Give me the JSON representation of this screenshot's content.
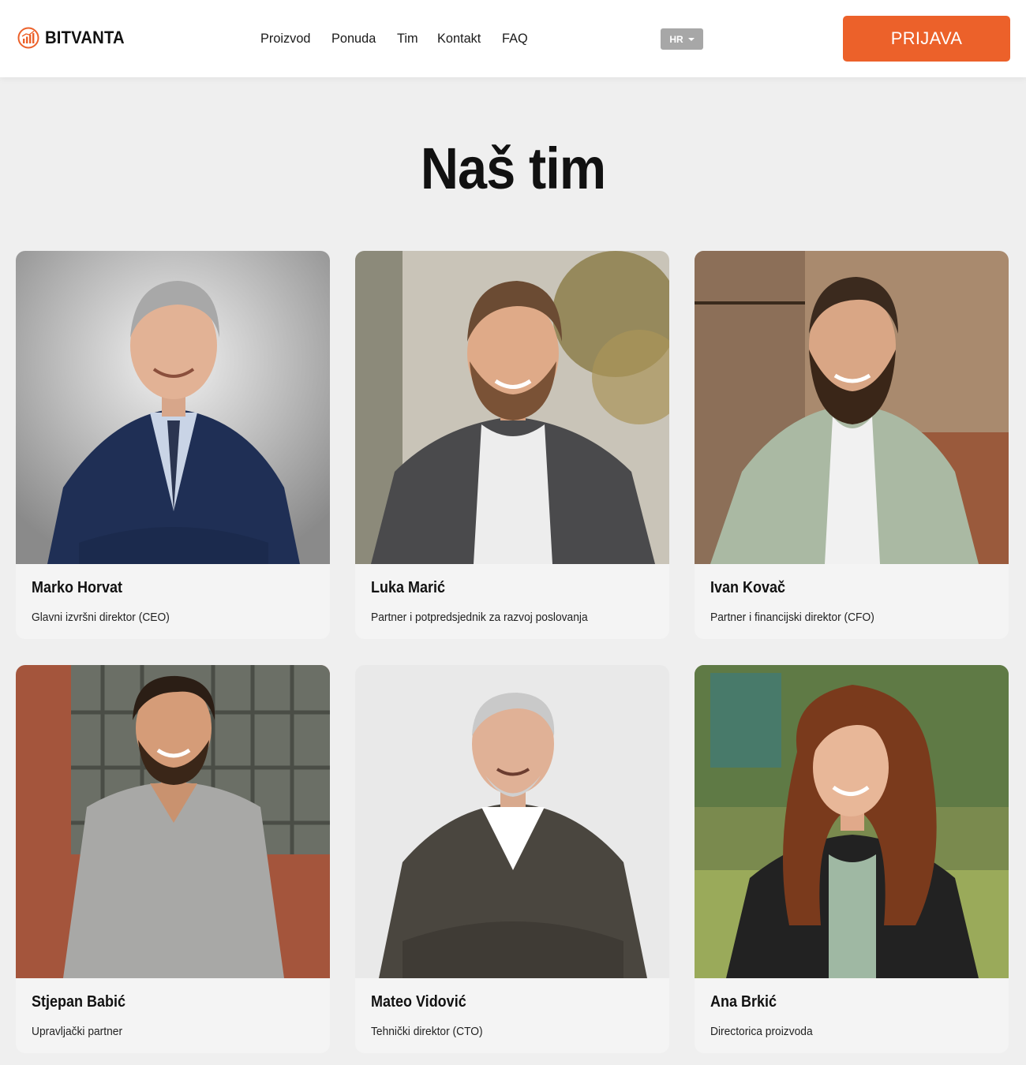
{
  "brand": {
    "name": "BITVANTA",
    "accent": "#ec612a"
  },
  "nav": [
    {
      "label": "Proizvod"
    },
    {
      "label": "Ponuda"
    },
    {
      "label": "Tim"
    },
    {
      "label": "Kontakt"
    },
    {
      "label": "FAQ"
    }
  ],
  "language": {
    "selected": "HR"
  },
  "login": {
    "label": "PRIJAVA"
  },
  "section": {
    "title": "Naš tim"
  },
  "team": [
    {
      "name": "Marko Horvat",
      "role": "Glavni izvršni direktor (CEO)"
    },
    {
      "name": "Luka Marić",
      "role": "Partner i potpredsjednik za razvoj poslovanja"
    },
    {
      "name": "Ivan Kovač",
      "role": "Partner i financijski direktor (CFO)"
    },
    {
      "name": "Stjepan Babić",
      "role": "Upravljački partner"
    },
    {
      "name": "Mateo Vidović",
      "role": "Tehnički direktor (CTO)"
    },
    {
      "name": "Ana Brkić",
      "role": "Directorica proizvoda"
    }
  ]
}
